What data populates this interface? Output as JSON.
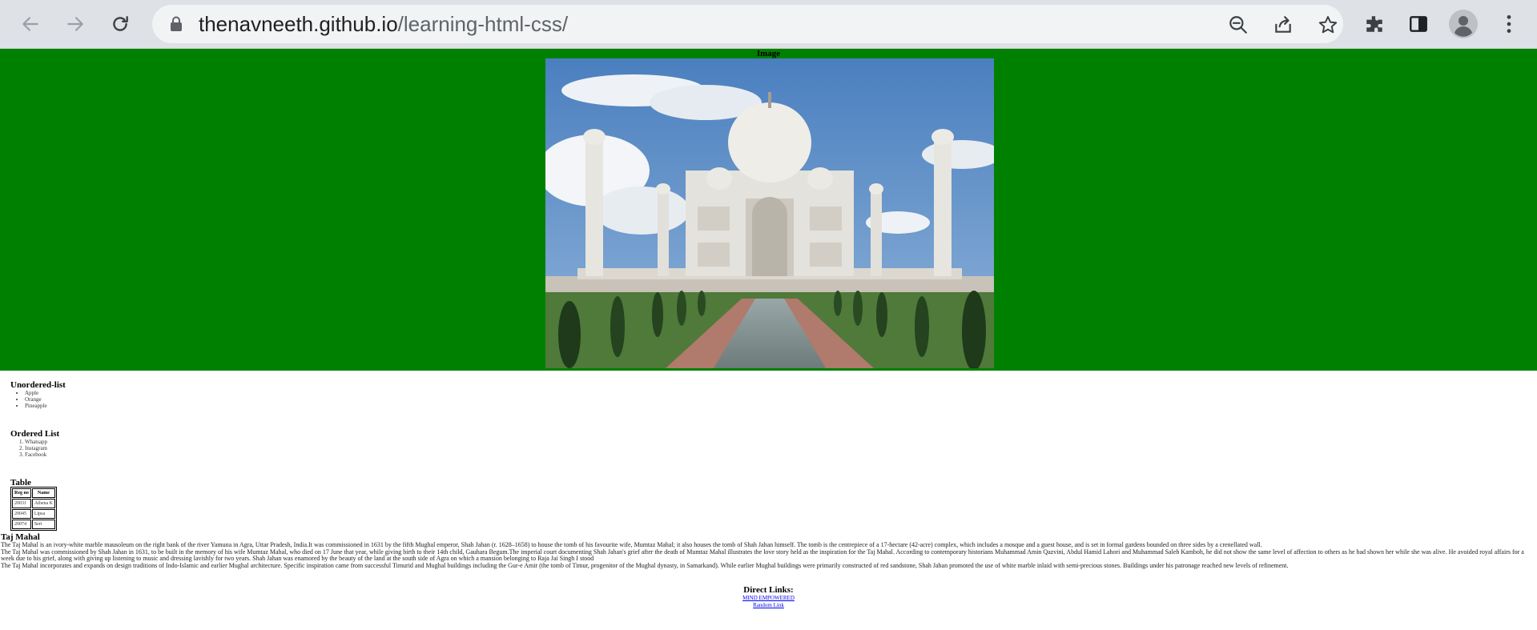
{
  "browser": {
    "url_host": "thenavneeth.github.io",
    "url_path": "/learning-html-css/",
    "icons": {
      "back": "arrow-left-icon",
      "forward": "arrow-right-icon",
      "reload": "reload-icon",
      "lock": "lock-icon",
      "zoom": "zoom-out-icon",
      "share": "share-icon",
      "bookmark": "star-icon",
      "extensions": "puzzle-icon",
      "sidepanel": "side-panel-icon",
      "profile": "profile-icon",
      "menu": "kebab-menu-icon"
    }
  },
  "page": {
    "hero_bg": "#008000",
    "image_caption": "Image",
    "unordered": {
      "title": "Unordered-list",
      "items": [
        "Apple",
        "Orange",
        "Pineapple"
      ]
    },
    "ordered": {
      "title": "Ordered List",
      "items": [
        "Whatsapp",
        "Instagram",
        "Facebook"
      ]
    },
    "table": {
      "title": "Table",
      "headers": [
        "Reg no",
        "Name"
      ],
      "rows": [
        [
          "20031",
          "Athena K"
        ],
        [
          "20045",
          "Lipsa"
        ],
        [
          "20074",
          "Seri"
        ]
      ]
    },
    "article": {
      "title": "Taj Mahal",
      "paragraphs": [
        "The Taj Mahal is an ivory-white marble mausoleum on the right bank of the river Yamuna in Agra, Uttar Pradesh, India.It was commissioned in 1631 by the fifth Mughal emperor, Shah Jahan (r. 1628–1658) to house the tomb of his favourite wife, Mumtaz Mahal; it also houses the tomb of Shah Jahan himself. The tomb is the centrepiece of a 17-hectare (42-acre) complex, which includes a mosque and a guest house, and is set in formal gardens bounded on three sides by a crenellated wall.",
        "The Taj Mahal was commissioned by Shah Jahan in 1631, to be built in the memory of his wife Mumtaz Mahal, who died on 17 June that year, while giving birth to their 14th child, Gauhara Begum.The imperial court documenting Shah Jahan's grief after the death of Mumtaz Mahal illustrates the love story held as the inspiration for the Taj Mahal. According to contemporary historians Muhammad Amin Qazvini, Abdul Hamid Lahori and Muhammad Saleh Kamboh, he did not show the same level of affection to others as he had shown her while she was alive. He avoided royal affairs for a week due to his grief, along with giving up listening to music and dressing lavishly for two years. Shah Jahan was enamored by the beauty of the land at the south side of Agra on which a mansion belonging to Raja Jai Singh I stood",
        "The Taj Mahal incorporates and expands on design traditions of Indo-Islamic and earlier Mughal architecture. Specific inspiration came from successful Timurid and Mughal buildings including the Gur-e Amir (the tomb of Timur, progenitor of the Mughal dynasty, in Samarkand). While earlier Mughal buildings were primarily constructed of red sandstone, Shah Jahan promoted the use of white marble inlaid with semi-precious stones. Buildings under his patronage reached new levels of refinement."
      ]
    },
    "direct_links": {
      "title": "Direct Links:",
      "links": [
        "MIND EMPOWERED",
        "Random Link"
      ]
    }
  }
}
